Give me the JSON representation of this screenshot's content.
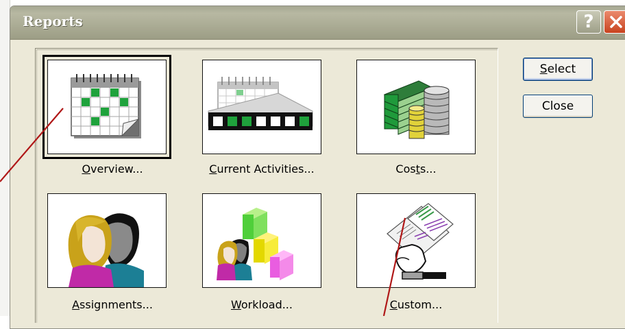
{
  "window": {
    "title": "Reports"
  },
  "title_buttons": {
    "help": "?",
    "close_icon": "close-icon"
  },
  "tiles": [
    {
      "label_before": "",
      "label_accel": "O",
      "label_after": "verview...",
      "icon": "calendar-icon",
      "selected": true
    },
    {
      "label_before": "",
      "label_accel": "C",
      "label_after": "urrent Activities...",
      "icon": "gantt-calendar-icon",
      "selected": false
    },
    {
      "label_before": "Cos",
      "label_accel": "t",
      "label_after": "s...",
      "icon": "money-stacks-icon",
      "selected": false
    },
    {
      "label_before": "",
      "label_accel": "A",
      "label_after": "ssignments...",
      "icon": "people-icon",
      "selected": false
    },
    {
      "label_before": "",
      "label_accel": "W",
      "label_after": "orkload...",
      "icon": "workload-blocks-icon",
      "selected": false
    },
    {
      "label_before": "",
      "label_accel": "C",
      "label_after": "ustom...",
      "icon": "custom-document-hand-icon",
      "selected": false
    }
  ],
  "buttons": {
    "select": {
      "accel": "S",
      "rest": "elect"
    },
    "close": "Close"
  },
  "colors": {
    "titlebar": "#aeaf98",
    "dialog_bg": "#ece9d8",
    "annotation_arrow": "#b01818",
    "accent_green": "#1fa23c"
  }
}
